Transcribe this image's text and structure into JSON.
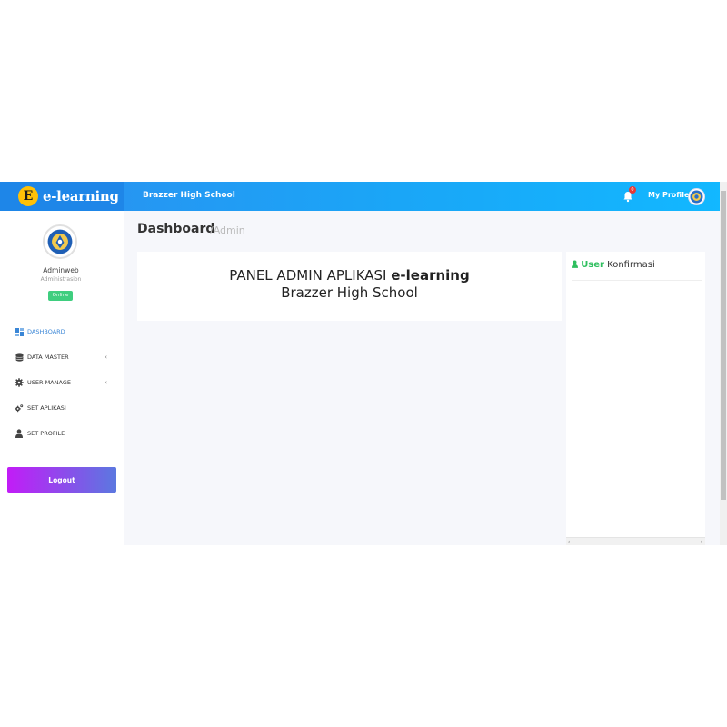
{
  "brand": {
    "logo_letter": "E",
    "name": "e-learning"
  },
  "header": {
    "school_name": "Brazzer High School",
    "notification_count": "0",
    "profile_label": "My Profile"
  },
  "sidebar": {
    "user_name": "Adminweb",
    "user_role": "Administrasion",
    "status": "Online",
    "menu": [
      {
        "label": "DASHBOARD",
        "icon": "dashboard-icon",
        "active": true
      },
      {
        "label": "DATA MASTER",
        "icon": "database-icon",
        "expandable": true
      },
      {
        "label": "USER MANAGE",
        "icon": "gear-icon",
        "expandable": true
      },
      {
        "label": "SET APLIKASI",
        "icon": "gears-icon"
      },
      {
        "label": "SET PROFILE",
        "icon": "user-icon"
      }
    ],
    "logout_label": "Logout"
  },
  "page": {
    "title": "Dashboard",
    "subtitle": "/Admin"
  },
  "panel": {
    "line1_prefix": "PANEL ADMIN APLIKASI ",
    "line1_brand": "e-learning",
    "line2": "Brazzer High School"
  },
  "konfirmasi": {
    "title_highlight": "User",
    "title_rest": " Konfirmasi"
  },
  "colors": {
    "header_start": "#2b8ff0",
    "header_end": "#12b8ff",
    "online": "#3fce7f",
    "logout_start": "#c21cf7",
    "logout_end": "#5b78e0",
    "accent_green": "#2fbf5f"
  }
}
